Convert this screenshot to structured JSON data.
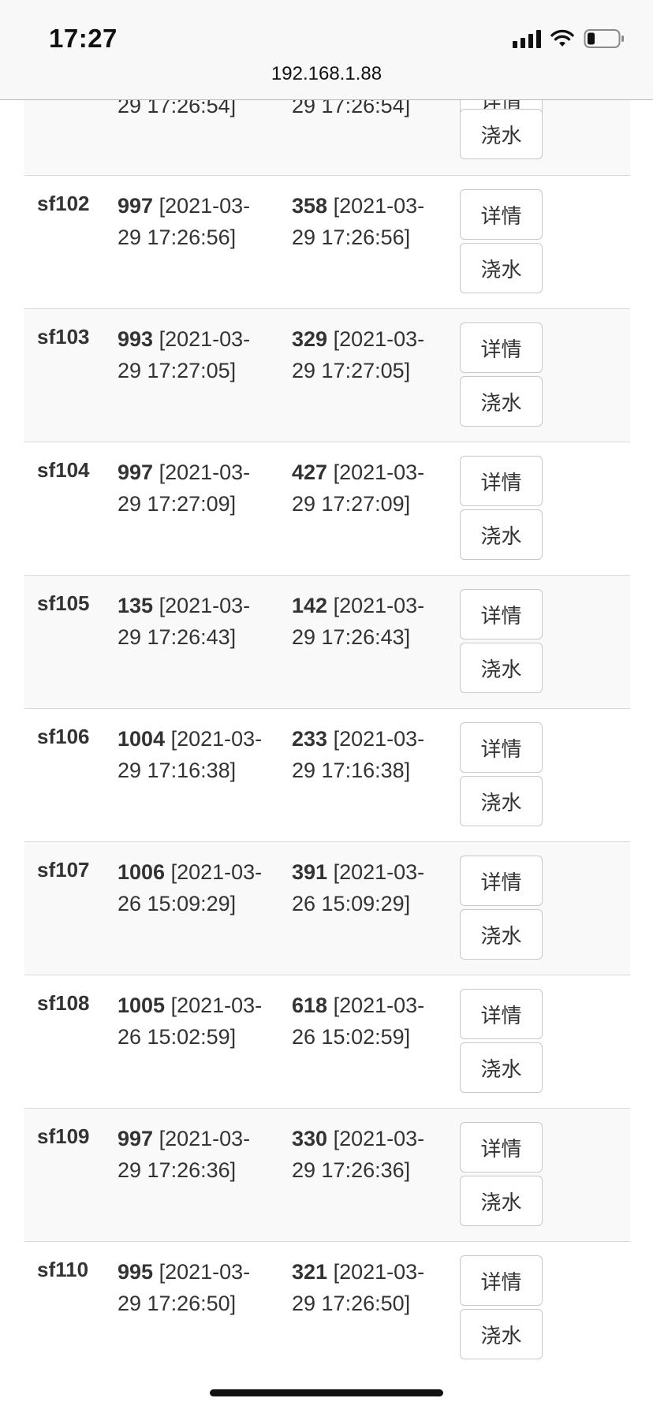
{
  "status_bar": {
    "time": "17:27"
  },
  "address_bar": {
    "url": "192.168.1.88"
  },
  "buttons": {
    "detail": "详情",
    "water": "浇水"
  },
  "top_partial": {
    "a_tail": "29 17:26:54]",
    "b_tail": "29 17:26:54]"
  },
  "rows": [
    {
      "id": "sf102",
      "a_val": "997",
      "a_time": " [2021-03-29 17:26:56]",
      "b_val": "358",
      "b_time": " [2021-03-29 17:26:56]"
    },
    {
      "id": "sf103",
      "a_val": "993",
      "a_time": " [2021-03-29 17:27:05]",
      "b_val": "329",
      "b_time": " [2021-03-29 17:27:05]"
    },
    {
      "id": "sf104",
      "a_val": "997",
      "a_time": " [2021-03-29 17:27:09]",
      "b_val": "427",
      "b_time": " [2021-03-29 17:27:09]"
    },
    {
      "id": "sf105",
      "a_val": "135",
      "a_time": " [2021-03-29 17:26:43]",
      "b_val": "142",
      "b_time": " [2021-03-29 17:26:43]"
    },
    {
      "id": "sf106",
      "a_val": "1004",
      "a_time": " [2021-03-29 17:16:38]",
      "b_val": "233",
      "b_time": " [2021-03-29 17:16:38]"
    },
    {
      "id": "sf107",
      "a_val": "1006",
      "a_time": " [2021-03-26 15:09:29]",
      "b_val": "391",
      "b_time": " [2021-03-26 15:09:29]"
    },
    {
      "id": "sf108",
      "a_val": "1005",
      "a_time": " [2021-03-26 15:02:59]",
      "b_val": "618",
      "b_time": " [2021-03-26 15:02:59]"
    },
    {
      "id": "sf109",
      "a_val": "997",
      "a_time": " [2021-03-29 17:26:36]",
      "b_val": "330",
      "b_time": " [2021-03-29 17:26:36]"
    },
    {
      "id": "sf110",
      "a_val": "995",
      "a_time": " [2021-03-29 17:26:50]",
      "b_val": "321",
      "b_time": " [2021-03-29 17:26:50]"
    }
  ]
}
